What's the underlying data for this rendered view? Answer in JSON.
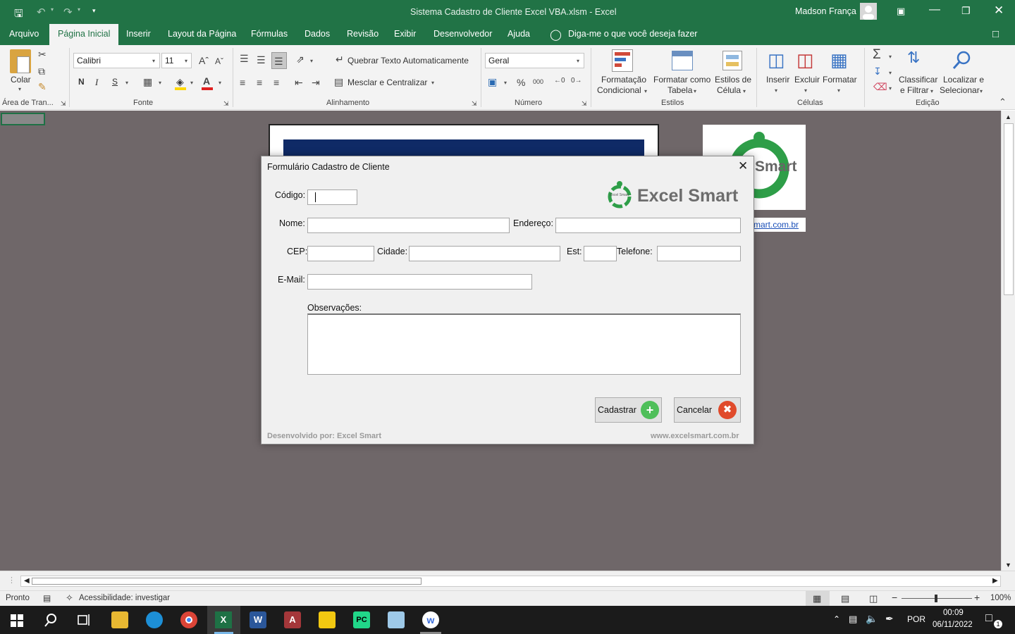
{
  "title": {
    "doc": "Sistema Cadastro de Cliente Excel VBA.xlsm  -  Excel",
    "user": "Madson França"
  },
  "tabs": [
    "Arquivo",
    "Página Inicial",
    "Inserir",
    "Layout da Página",
    "Fórmulas",
    "Dados",
    "Revisão",
    "Exibir",
    "Desenvolvedor",
    "Ajuda"
  ],
  "tell_me": "Diga-me o que você deseja fazer",
  "ribbon": {
    "paste": "Colar",
    "clipboard": "Área de Tran...",
    "font_name": "Calibri",
    "font_size": "11",
    "bold": "N",
    "italic": "I",
    "underline": "S",
    "font_group": "Fonte",
    "wrap": "Quebrar Texto Automaticamente",
    "merge": "Mesclar e Centralizar",
    "align_group": "Alinhamento",
    "number_format": "Geral",
    "number_group": "Número",
    "cond_format": [
      "Formatação",
      "Condicional"
    ],
    "format_table": [
      "Formatar como",
      "Tabela"
    ],
    "cell_styles": [
      "Estilos de",
      "Célula"
    ],
    "styles_group": "Estilos",
    "insert": "Inserir",
    "delete": "Excluir",
    "format": "Formatar",
    "cells_group": "Células",
    "sort": [
      "Classificar",
      "e Filtrar"
    ],
    "find": [
      "Localizar e",
      "Selecionar"
    ],
    "edit_group": "Edição"
  },
  "sheet": {
    "logo_text": "Smart",
    "link": "mart.com.br"
  },
  "dialog": {
    "title": "Formulário Cadastro de Cliente",
    "brand": "Excel Smart",
    "brand_small": "Excel Smart",
    "labels": {
      "code": "Código:",
      "name": "Nome:",
      "address": "Endereço:",
      "cep": "CEP:",
      "city": "Cidade:",
      "state": "Est:",
      "phone": "Telefone:",
      "email": "E-Mail:",
      "notes": "Observações:"
    },
    "values": {
      "code": "",
      "name": "",
      "address": "",
      "cep": "",
      "city": "",
      "state": "",
      "phone": "",
      "email": "",
      "notes": ""
    },
    "submit": "Cadastrar",
    "cancel": "Cancelar",
    "footer_left": "Desenvolvido por: Excel Smart",
    "footer_right": "www.excelsmart.com.br"
  },
  "status": {
    "ready": "Pronto",
    "accessibility": "Acessibilidade: investigar",
    "zoom": "100%"
  },
  "taskbar": {
    "lang": "POR",
    "time": "00:09",
    "date": "06/11/2022",
    "notif": "1"
  },
  "colors": {
    "excel_green": "#217346",
    "dialog_navy": "#0f2a66",
    "brand_green": "#2e9e48",
    "cancel_red": "#e04a2b"
  }
}
